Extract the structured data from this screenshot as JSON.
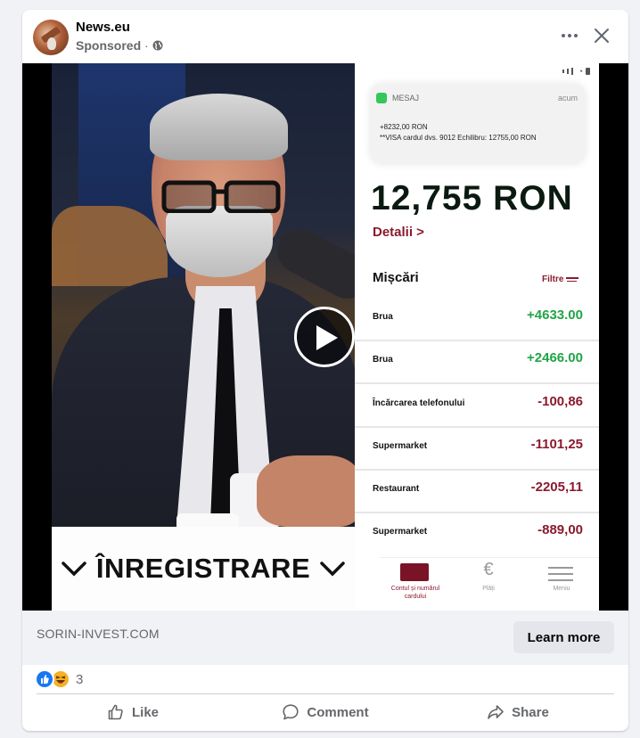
{
  "post": {
    "page_name": "News.eu",
    "sponsored_label": "Sponsored",
    "separator": "·",
    "privacy_icon": "globe-icon"
  },
  "media": {
    "banner_text": "ÎNREGISTRARE",
    "play_icon": "play-icon",
    "phone": {
      "notification": {
        "app_name": "MESAJ",
        "time": "acum",
        "line1": "+8232,00 RON",
        "line2": "**VISA cardul dvs. 9012 Echilibru: 12755,00 RON"
      },
      "balance": "12,755 RON",
      "details_link": "Detalii >",
      "movements_title": "Mișcări",
      "filter_label": "Filtre",
      "transactions": [
        {
          "name": "Brua",
          "amount": "+4633.00",
          "type": "positive"
        },
        {
          "name": "Brua",
          "amount": "+2466.00",
          "type": "positive"
        },
        {
          "name": "Încărcarea telefonului",
          "amount": "-100,86",
          "type": "negative"
        },
        {
          "name": "Supermarket",
          "amount": "-1101,25",
          "type": "negative"
        },
        {
          "name": "Restaurant",
          "amount": "-2205,11",
          "type": "negative"
        },
        {
          "name": "Supermarket",
          "amount": "-889,00",
          "type": "negative"
        }
      ],
      "tabs": [
        {
          "label": "Contul și numărul cardului",
          "icon": "card-icon"
        },
        {
          "label": "Plăți",
          "icon": "euro-icon"
        },
        {
          "label": "Meniu",
          "icon": "menu-icon"
        }
      ]
    }
  },
  "link": {
    "domain": "SORIN-INVEST.COM",
    "cta_label": "Learn more"
  },
  "reactions": {
    "count": "3",
    "icons": [
      "like-icon",
      "haha-icon"
    ]
  },
  "actions": {
    "like": "Like",
    "comment": "Comment",
    "share": "Share"
  },
  "colors": {
    "brand_blue": "#1877f2",
    "bank_red": "#8b1a2e",
    "money_green": "#22a447",
    "secondary_text": "#65676b"
  }
}
